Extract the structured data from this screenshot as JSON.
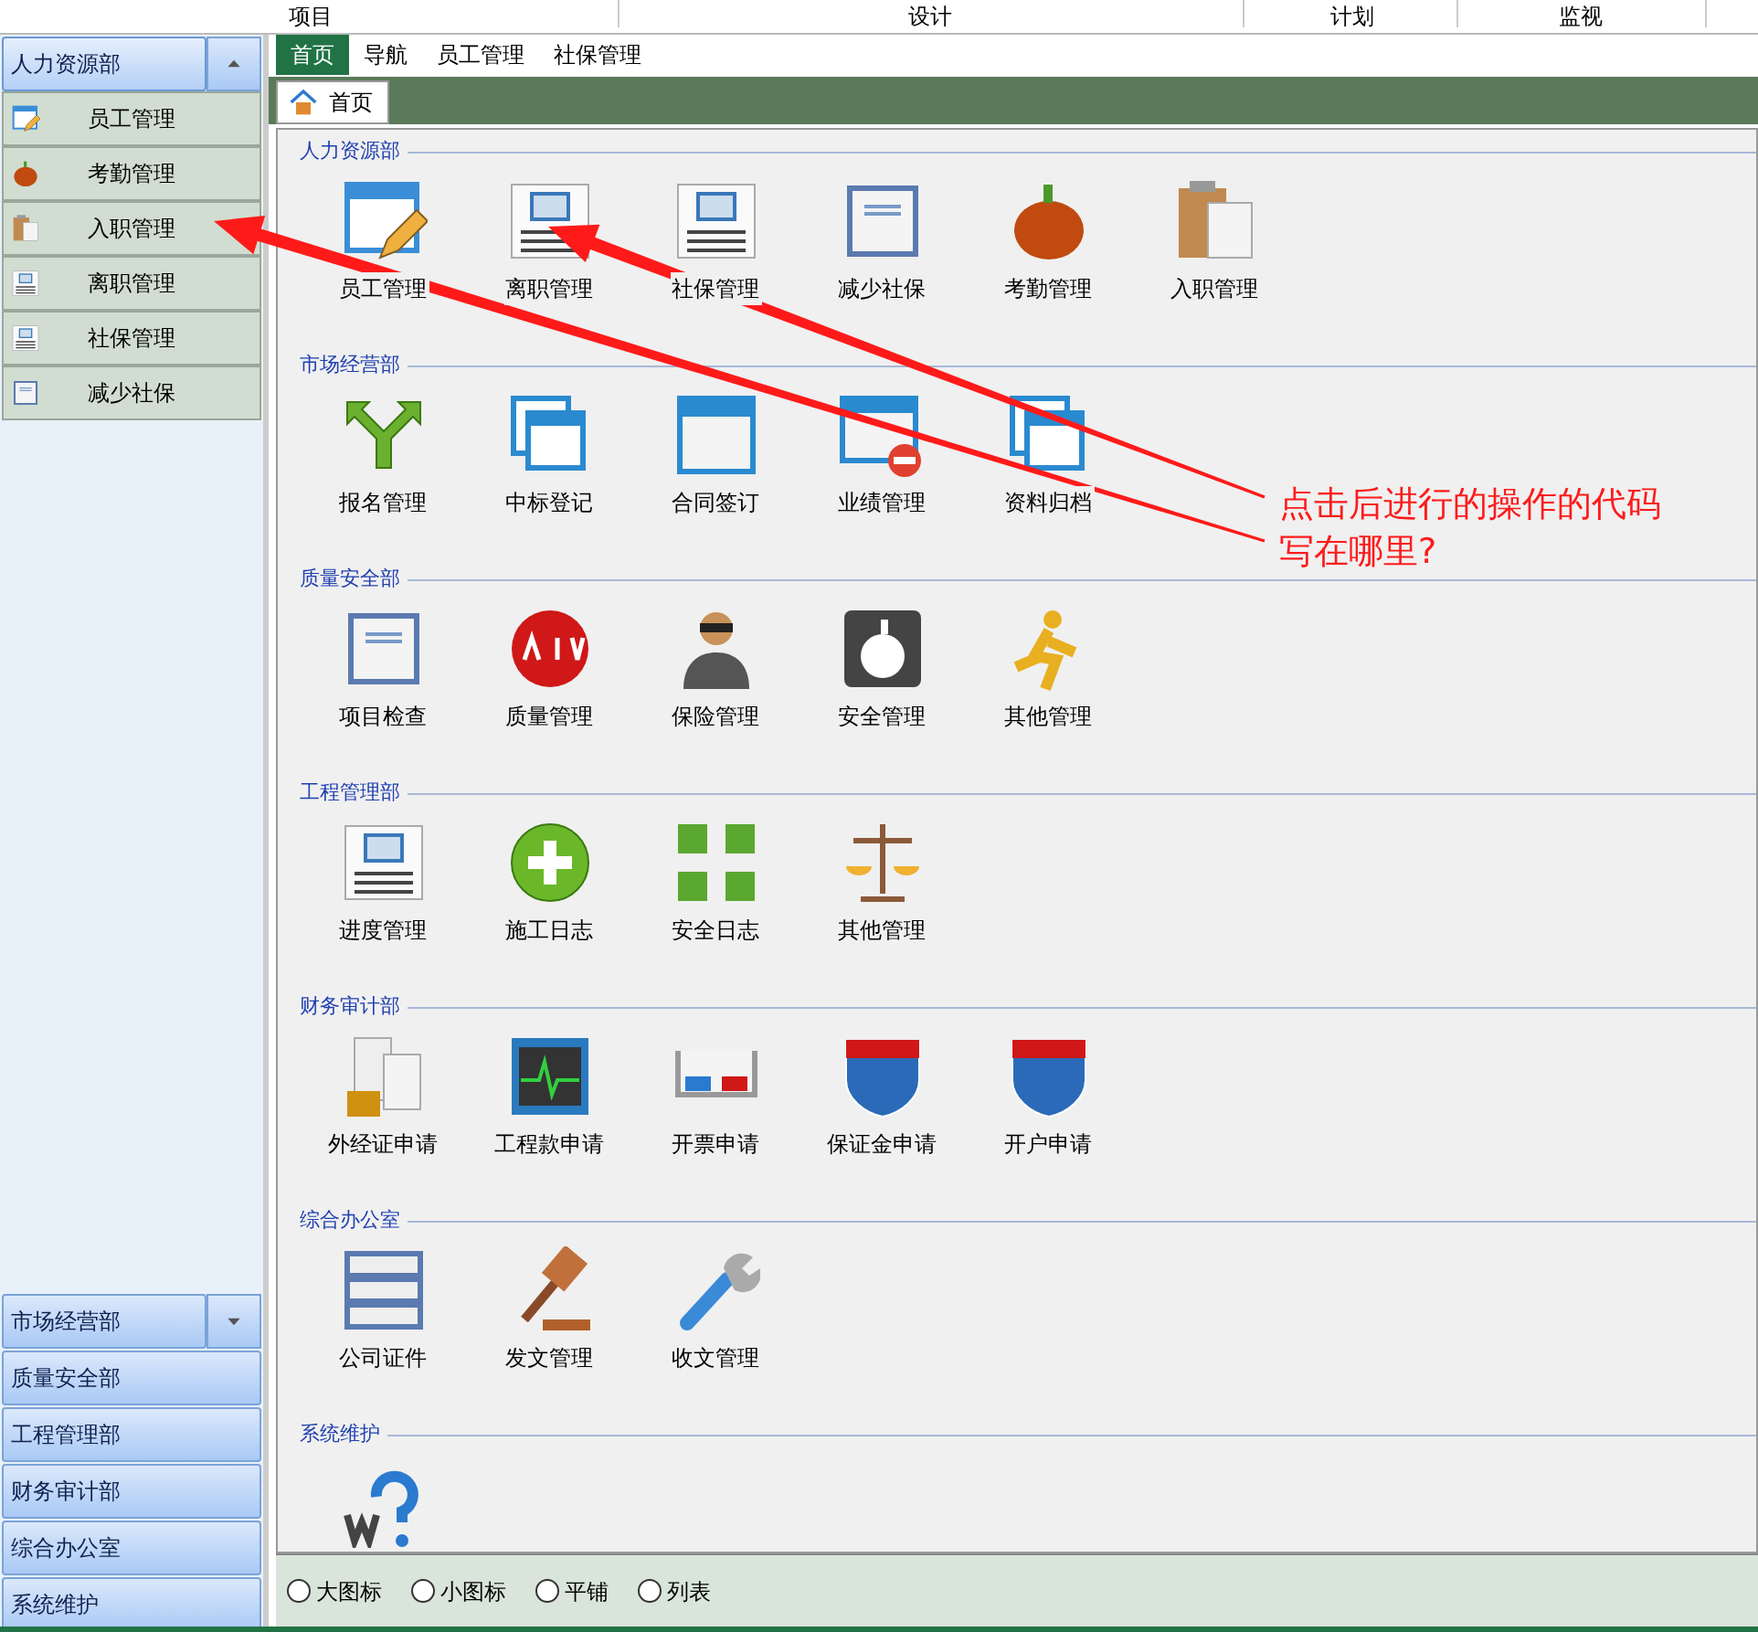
{
  "menu_bar": [
    {
      "label": "项目"
    },
    {
      "label": "设计"
    },
    {
      "label": "计划"
    },
    {
      "label": "监视"
    }
  ],
  "sidebar": {
    "groups": [
      {
        "title": "人力资源部",
        "expanded": true,
        "items": [
          {
            "label": "员工管理"
          },
          {
            "label": "考勤管理"
          },
          {
            "label": "入职管理"
          },
          {
            "label": "离职管理"
          },
          {
            "label": "社保管理"
          },
          {
            "label": "减少社保"
          }
        ]
      },
      {
        "title": "市场经营部",
        "expanded": false
      },
      {
        "title": "质量安全部",
        "expanded": false
      },
      {
        "title": "工程管理部",
        "expanded": false
      },
      {
        "title": "财务审计部",
        "expanded": false
      },
      {
        "title": "综合办公室",
        "expanded": false
      },
      {
        "title": "系统维护",
        "expanded": false
      }
    ]
  },
  "top_tabs": [
    {
      "label": "首页",
      "selected": true
    },
    {
      "label": "导航",
      "selected": false
    },
    {
      "label": "员工管理",
      "selected": false
    },
    {
      "label": "社保管理",
      "selected": false
    }
  ],
  "document_tab": {
    "label": "首页"
  },
  "sections": [
    {
      "title": "人力资源部",
      "items": [
        {
          "label": "员工管理"
        },
        {
          "label": "离职管理"
        },
        {
          "label": "社保管理"
        },
        {
          "label": "减少社保"
        },
        {
          "label": "考勤管理"
        },
        {
          "label": "入职管理"
        }
      ]
    },
    {
      "title": "市场经营部",
      "items": [
        {
          "label": "报名管理"
        },
        {
          "label": "中标登记"
        },
        {
          "label": "合同签订"
        },
        {
          "label": "业绩管理"
        },
        {
          "label": "资料归档"
        }
      ]
    },
    {
      "title": "质量安全部",
      "items": [
        {
          "label": "项目检查"
        },
        {
          "label": "质量管理"
        },
        {
          "label": "保险管理"
        },
        {
          "label": "安全管理"
        },
        {
          "label": "其他管理"
        }
      ]
    },
    {
      "title": "工程管理部",
      "items": [
        {
          "label": "进度管理"
        },
        {
          "label": "施工日志"
        },
        {
          "label": "安全日志"
        },
        {
          "label": "其他管理"
        }
      ]
    },
    {
      "title": "财务审计部",
      "items": [
        {
          "label": "外经证申请"
        },
        {
          "label": "工程款申请"
        },
        {
          "label": "开票申请"
        },
        {
          "label": "保证金申请"
        },
        {
          "label": "开户申请"
        }
      ]
    },
    {
      "title": "综合办公室",
      "items": [
        {
          "label": "公司证件"
        },
        {
          "label": "发文管理"
        },
        {
          "label": "收文管理"
        }
      ]
    },
    {
      "title": "系统维护",
      "items": [
        {
          "kind": "icon_only"
        }
      ]
    }
  ],
  "view_options": [
    {
      "label": "大图标",
      "selected": false
    },
    {
      "label": "小图标",
      "selected": false
    },
    {
      "label": "平铺",
      "selected": false
    },
    {
      "label": "列表",
      "selected": false
    }
  ],
  "annotation": {
    "lines": [
      "点击后进行的操作的代码",
      "写在哪里?"
    ]
  }
}
